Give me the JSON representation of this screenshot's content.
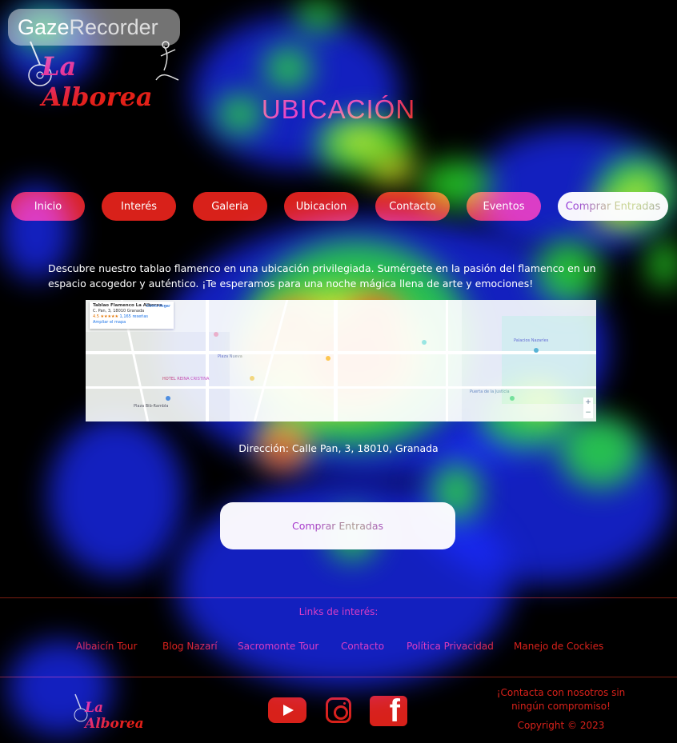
{
  "watermark": {
    "gaze": "Gaze",
    "recorder": "Recorder"
  },
  "logo": {
    "text": "La Alborea"
  },
  "page_title": "UBICACIÓN",
  "nav": {
    "items": [
      {
        "label": "Inicio"
      },
      {
        "label": "Interés"
      },
      {
        "label": "Galeria"
      },
      {
        "label": "Ubicacion"
      },
      {
        "label": "Contacto"
      },
      {
        "label": "Eventos"
      },
      {
        "label": "Comprar Entradas"
      }
    ]
  },
  "intro": "Descubre nuestro tablao flamenco en una ubicación privilegiada. Sumérgete en la pasión del flamenco en un espacio acogedor y auténtico. ¡Te esperamos para una noche mágica llena de arte y emociones!",
  "map": {
    "card_title": "Tablao Flamenco La Alborea ...",
    "card_address": "C. Pan, 3, 18010 Granada",
    "card_rating": "4.5 ★★★★★",
    "card_reviews": "1,165 reseñas",
    "card_link": "Ampliar el mapa",
    "card_directions": "Cómo llegar",
    "labels": [
      "Plaza Nueva",
      "HOTEL REINA CRISTINA",
      "Plaza Bib-Rambla",
      "Palacios Nazaríes",
      "Puerta de la Justicia"
    ],
    "zoom_in": "+",
    "zoom_out": "−"
  },
  "address": {
    "label": "Dirección:",
    "value": "Calle Pan, 3, 18010, Granada"
  },
  "buy_button": "Comprar Entradas",
  "footer": {
    "links_title": "Links de interés:",
    "links": [
      "Albaicín Tour",
      "Blog Nazarí",
      "Sacromonte Tour",
      "Contacto",
      "Política Privacidad",
      "Manejo de Cockies"
    ],
    "contact_text": "¡Contacta con nosotros sin ningún compromiso!",
    "copyright": "Copyright © 2023",
    "social": [
      "youtube-icon",
      "instagram-icon",
      "facebook-icon"
    ],
    "facebook_glyph": "f"
  },
  "colors": {
    "brand_red": "#d8211a",
    "button_light": "#f6f4f8",
    "background": "#000000"
  }
}
